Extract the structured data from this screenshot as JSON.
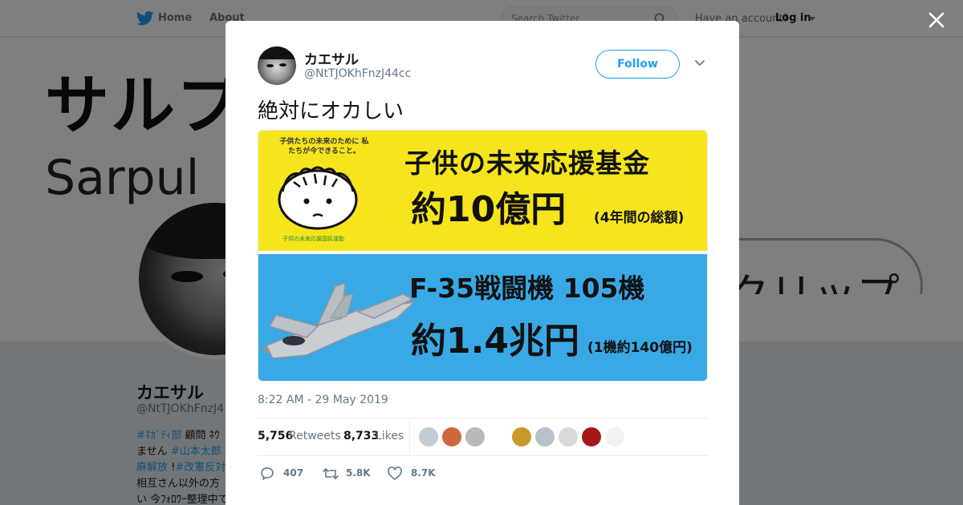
{
  "nav": {
    "home_label": "Home",
    "about_label": "About",
    "search_placeholder": "Search Twitter",
    "account_prompt": "Have an account?",
    "login_label": "Log in"
  },
  "background_profile": {
    "banner_title": "サルプル",
    "banner_subtitle": "Sarpul",
    "banner_badge": "クリップ",
    "name": "カエサル",
    "handle": "@NtTJOKhFnzJ4",
    "bio_lines": [
      {
        "parts": [
          {
            "t": "#ﾈｶﾞﾃｨ部",
            "tag": true
          },
          {
            "t": " 顧問 ﾈｳ",
            "tag": false
          }
        ]
      },
      {
        "parts": [
          {
            "t": "ません ",
            "tag": false
          },
          {
            "t": "#山本太郎",
            "tag": true
          }
        ]
      },
      {
        "parts": [
          {
            "t": "麻解放",
            "tag": true
          },
          {
            "t": " !",
            "tag": false
          },
          {
            "t": "#改憲反対",
            "tag": true
          }
        ]
      },
      {
        "parts": [
          {
            "t": "相互さん以外の方",
            "tag": false
          }
        ]
      },
      {
        "parts": [
          {
            "t": "い 今ﾌｫﾛﾜｰ整理中で",
            "tag": false
          }
        ]
      }
    ]
  },
  "tweet": {
    "author_name": "カエサル",
    "author_handle": "@NtTJOKhFnzJ44cc",
    "follow_label": "Follow",
    "text": "絶対にオカしい",
    "image": {
      "slogan": "子供たちの未来のために 私たちが今できること。",
      "logo_text": "子供の未来応援国民運動",
      "fund_title": "子供の未来応援基金",
      "fund_amount": "約10億円",
      "fund_note": "(4年間の総額)",
      "f35_title": "F-35戦闘機 105機",
      "f35_amount": "約1.4兆円",
      "f35_note": "(1機約140億円)"
    },
    "timestamp": "8:22 AM - 29 May 2019",
    "retweets_count": "5,756",
    "retweets_label": "Retweets",
    "likes_count": "8,733",
    "likes_label": "Likes",
    "likers": [
      {
        "name": "liker-1",
        "color": "#c3cbd3"
      },
      {
        "name": "liker-2",
        "color": "#d0673a"
      },
      {
        "name": "liker-3",
        "color": "#b9b9b9"
      },
      {
        "name": "liker-4",
        "color": "#ffffff"
      },
      {
        "name": "liker-5",
        "color": "#c89a2a"
      },
      {
        "name": "liker-6",
        "color": "#b8c1ca"
      },
      {
        "name": "liker-7",
        "color": "#d9d9d9"
      },
      {
        "name": "liker-8",
        "color": "#a61818"
      },
      {
        "name": "liker-9",
        "color": "#f2f2f2"
      }
    ],
    "reply_count": "407",
    "retweet_action_count": "5.8K",
    "like_action_count": "8.7K"
  },
  "colors": {
    "twitter_blue": "#1da1f2",
    "fund_yellow": "#f6e51c",
    "f35_blue": "#39a9e6"
  }
}
